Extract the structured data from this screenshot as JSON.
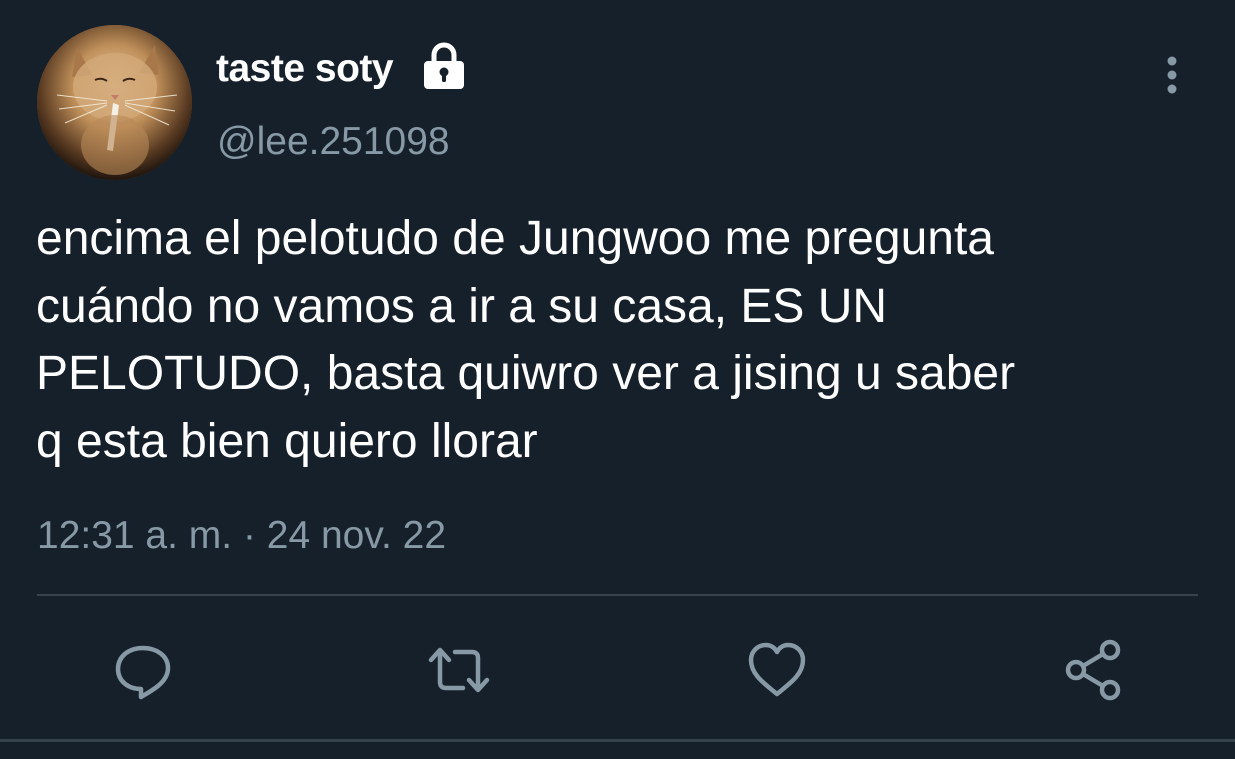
{
  "author": {
    "display_name": "taste soty",
    "handle": "@lee.251098",
    "avatar_icon": "cat-avatar-image",
    "protected_icon": "lock-icon"
  },
  "tweet": {
    "text_lines": [
      "encima el pelotudo de Jungwoo me pregunta",
      "cuándo no vamos a ir a su casa, ES UN",
      "PELOTUDO, basta quiwro ver a jising u saber",
      "q esta bien quiero llorar"
    ],
    "timestamp": "12:31 a. m. · 24 nov. 22"
  },
  "actions": [
    {
      "name": "reply",
      "icon": "reply-icon"
    },
    {
      "name": "retweet",
      "icon": "retweet-icon"
    },
    {
      "name": "like",
      "icon": "heart-icon"
    },
    {
      "name": "share",
      "icon": "share-icon"
    }
  ],
  "menu_icon": "more-vertical-icon",
  "colors": {
    "background": "#15202b",
    "primary_text": "#ffffff",
    "secondary_text": "#8899a6",
    "divider": "#38444d"
  }
}
